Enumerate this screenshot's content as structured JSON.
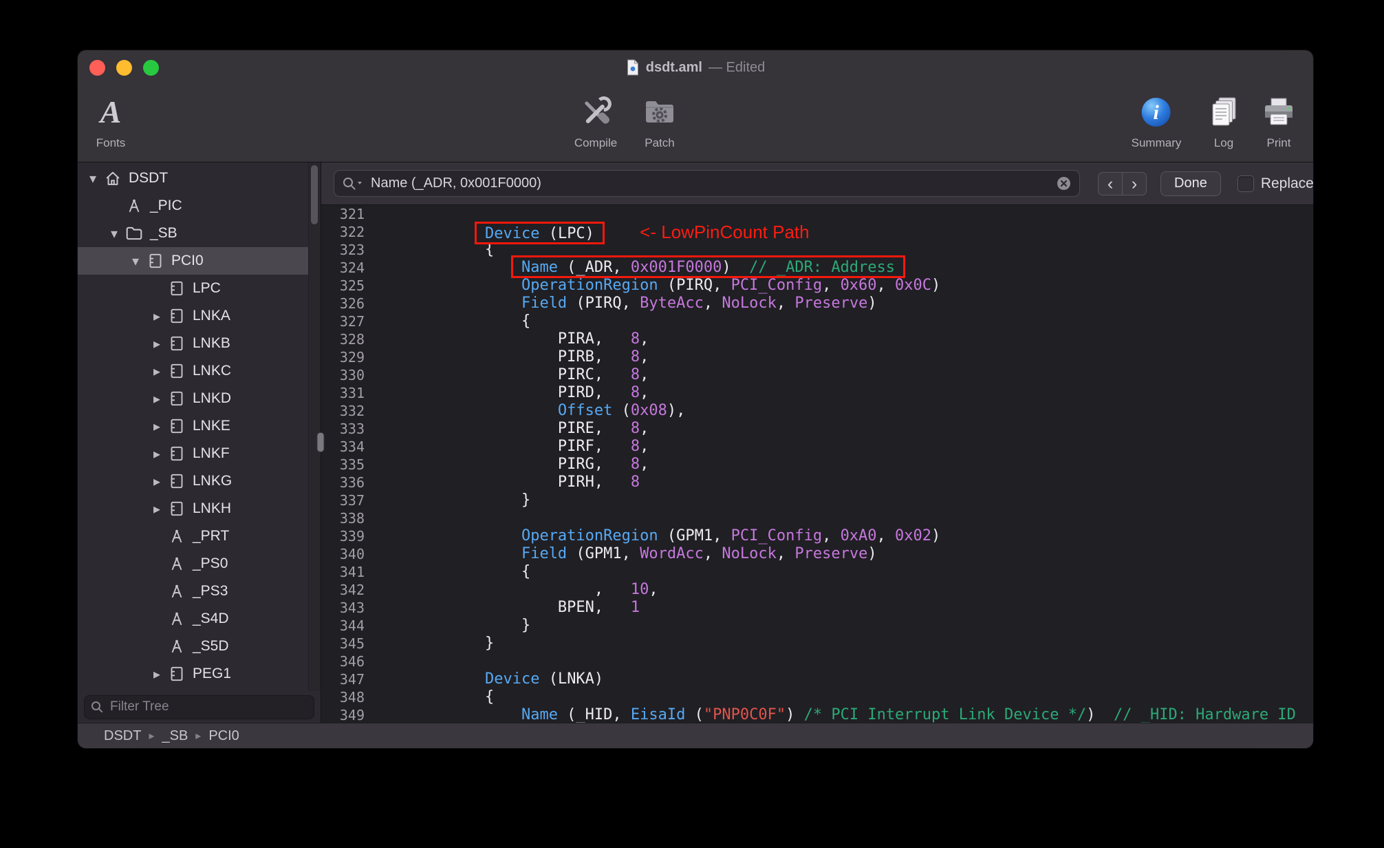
{
  "window": {
    "title": "dsdt.aml",
    "title_suffix": "— Edited"
  },
  "toolbar": {
    "fonts_glyph": "A",
    "fonts": "Fonts",
    "compile": "Compile",
    "patch": "Patch",
    "summary": "Summary",
    "log": "Log",
    "print": "Print"
  },
  "sidebar": {
    "items": [
      {
        "label": "DSDT",
        "icon": "house",
        "indent": 0,
        "disclosure": "open"
      },
      {
        "label": "_PIC",
        "icon": "method",
        "indent": 1,
        "disclosure": "none"
      },
      {
        "label": "_SB",
        "icon": "folder",
        "indent": 1,
        "disclosure": "open"
      },
      {
        "label": "PCI0",
        "icon": "device",
        "indent": 2,
        "disclosure": "open",
        "selected": true
      },
      {
        "label": "LPC",
        "icon": "device",
        "indent": 3,
        "disclosure": "none"
      },
      {
        "label": "LNKA",
        "icon": "device",
        "indent": 3,
        "disclosure": "closed"
      },
      {
        "label": "LNKB",
        "icon": "device",
        "indent": 3,
        "disclosure": "closed"
      },
      {
        "label": "LNKC",
        "icon": "device",
        "indent": 3,
        "disclosure": "closed"
      },
      {
        "label": "LNKD",
        "icon": "device",
        "indent": 3,
        "disclosure": "closed"
      },
      {
        "label": "LNKE",
        "icon": "device",
        "indent": 3,
        "disclosure": "closed"
      },
      {
        "label": "LNKF",
        "icon": "device",
        "indent": 3,
        "disclosure": "closed"
      },
      {
        "label": "LNKG",
        "icon": "device",
        "indent": 3,
        "disclosure": "closed"
      },
      {
        "label": "LNKH",
        "icon": "device",
        "indent": 3,
        "disclosure": "closed"
      },
      {
        "label": "_PRT",
        "icon": "method",
        "indent": 3,
        "disclosure": "none"
      },
      {
        "label": "_PS0",
        "icon": "method",
        "indent": 3,
        "disclosure": "none"
      },
      {
        "label": "_PS3",
        "icon": "method",
        "indent": 3,
        "disclosure": "none"
      },
      {
        "label": "_S4D",
        "icon": "method",
        "indent": 3,
        "disclosure": "none"
      },
      {
        "label": "_S5D",
        "icon": "method",
        "indent": 3,
        "disclosure": "none"
      },
      {
        "label": "PEG1",
        "icon": "device",
        "indent": 3,
        "disclosure": "closed"
      }
    ],
    "filter_placeholder": "Filter Tree",
    "breadcrumb": [
      "DSDT",
      "_SB",
      "PCI0"
    ],
    "breadcrumb_separator": "▸"
  },
  "findbar": {
    "query": "Name (_ADR, 0x001F0000)",
    "prev": "‹",
    "next": "›",
    "done": "Done",
    "replace": "Replace"
  },
  "annotation": {
    "text": "<- LowPinCount Path",
    "color": "#FB1D12"
  },
  "editor": {
    "lines": [
      {
        "n": 321,
        "s": []
      },
      {
        "n": 322,
        "s": [
          {
            "t": "        "
          },
          {
            "t": "Device",
            "c": "k",
            "w": 1
          },
          {
            "t": " (LPC)",
            "w": 1
          },
          {
            "t": "     "
          },
          {
            "t": "<- LowPinCount Path",
            "c": "a"
          }
        ]
      },
      {
        "n": 323,
        "s": [
          {
            "t": "        {"
          }
        ]
      },
      {
        "n": 324,
        "s": [
          {
            "t": "            "
          },
          {
            "t": "Name",
            "c": "k",
            "w": 1
          },
          {
            "t": " (_ADR, ",
            "w": 1
          },
          {
            "t": "0x001F0000",
            "c": "n",
            "w": 1
          },
          {
            "t": ")  ",
            "w": 1
          },
          {
            "t": "// _ADR: Address",
            "c": "c",
            "w": 1
          }
        ]
      },
      {
        "n": 325,
        "s": [
          {
            "t": "            "
          },
          {
            "t": "OperationRegion",
            "c": "k"
          },
          {
            "t": " (PIRQ, "
          },
          {
            "t": "PCI_Config",
            "c": "n"
          },
          {
            "t": ", "
          },
          {
            "t": "0x60",
            "c": "n"
          },
          {
            "t": ", "
          },
          {
            "t": "0x0C",
            "c": "n"
          },
          {
            "t": ")"
          }
        ]
      },
      {
        "n": 326,
        "s": [
          {
            "t": "            "
          },
          {
            "t": "Field",
            "c": "k"
          },
          {
            "t": " (PIRQ, "
          },
          {
            "t": "ByteAcc",
            "c": "n"
          },
          {
            "t": ", "
          },
          {
            "t": "NoLock",
            "c": "n"
          },
          {
            "t": ", "
          },
          {
            "t": "Preserve",
            "c": "n"
          },
          {
            "t": ")"
          }
        ]
      },
      {
        "n": 327,
        "s": [
          {
            "t": "            {"
          }
        ]
      },
      {
        "n": 328,
        "s": [
          {
            "t": "                PIRA,   "
          },
          {
            "t": "8",
            "c": "n"
          },
          {
            "t": ","
          }
        ]
      },
      {
        "n": 329,
        "s": [
          {
            "t": "                PIRB,   "
          },
          {
            "t": "8",
            "c": "n"
          },
          {
            "t": ","
          }
        ]
      },
      {
        "n": 330,
        "s": [
          {
            "t": "                PIRC,   "
          },
          {
            "t": "8",
            "c": "n"
          },
          {
            "t": ","
          }
        ]
      },
      {
        "n": 331,
        "s": [
          {
            "t": "                PIRD,   "
          },
          {
            "t": "8",
            "c": "n"
          },
          {
            "t": ","
          }
        ]
      },
      {
        "n": 332,
        "s": [
          {
            "t": "                "
          },
          {
            "t": "Offset",
            "c": "k"
          },
          {
            "t": " ("
          },
          {
            "t": "0x08",
            "c": "n"
          },
          {
            "t": "),"
          }
        ]
      },
      {
        "n": 333,
        "s": [
          {
            "t": "                PIRE,   "
          },
          {
            "t": "8",
            "c": "n"
          },
          {
            "t": ","
          }
        ]
      },
      {
        "n": 334,
        "s": [
          {
            "t": "                PIRF,   "
          },
          {
            "t": "8",
            "c": "n"
          },
          {
            "t": ","
          }
        ]
      },
      {
        "n": 335,
        "s": [
          {
            "t": "                PIRG,   "
          },
          {
            "t": "8",
            "c": "n"
          },
          {
            "t": ","
          }
        ]
      },
      {
        "n": 336,
        "s": [
          {
            "t": "                PIRH,   "
          },
          {
            "t": "8",
            "c": "n"
          }
        ]
      },
      {
        "n": 337,
        "s": [
          {
            "t": "            }"
          }
        ]
      },
      {
        "n": 338,
        "s": []
      },
      {
        "n": 339,
        "s": [
          {
            "t": "            "
          },
          {
            "t": "OperationRegion",
            "c": "k"
          },
          {
            "t": " (GPM1, "
          },
          {
            "t": "PCI_Config",
            "c": "n"
          },
          {
            "t": ", "
          },
          {
            "t": "0xA0",
            "c": "n"
          },
          {
            "t": ", "
          },
          {
            "t": "0x02",
            "c": "n"
          },
          {
            "t": ")"
          }
        ]
      },
      {
        "n": 340,
        "s": [
          {
            "t": "            "
          },
          {
            "t": "Field",
            "c": "k"
          },
          {
            "t": " (GPM1, "
          },
          {
            "t": "WordAcc",
            "c": "n"
          },
          {
            "t": ", "
          },
          {
            "t": "NoLock",
            "c": "n"
          },
          {
            "t": ", "
          },
          {
            "t": "Preserve",
            "c": "n"
          },
          {
            "t": ")"
          }
        ]
      },
      {
        "n": 341,
        "s": [
          {
            "t": "            {"
          }
        ]
      },
      {
        "n": 342,
        "s": [
          {
            "t": "                    ,   "
          },
          {
            "t": "10",
            "c": "n"
          },
          {
            "t": ","
          }
        ]
      },
      {
        "n": 343,
        "s": [
          {
            "t": "                BPEN,   "
          },
          {
            "t": "1",
            "c": "n"
          }
        ]
      },
      {
        "n": 344,
        "s": [
          {
            "t": "            }"
          }
        ]
      },
      {
        "n": 345,
        "s": [
          {
            "t": "        }"
          }
        ]
      },
      {
        "n": 346,
        "s": []
      },
      {
        "n": 347,
        "s": [
          {
            "t": "        "
          },
          {
            "t": "Device",
            "c": "k"
          },
          {
            "t": " (LNKA)"
          }
        ]
      },
      {
        "n": 348,
        "s": [
          {
            "t": "        {"
          }
        ]
      },
      {
        "n": 349,
        "s": [
          {
            "t": "            "
          },
          {
            "t": "Name",
            "c": "k"
          },
          {
            "t": " (_HID, "
          },
          {
            "t": "EisaId",
            "c": "k"
          },
          {
            "t": " ("
          },
          {
            "t": "\"PNP0C0F\"",
            "c": "s"
          },
          {
            "t": ") "
          },
          {
            "t": "/* PCI Interrupt Link Device */",
            "c": "c"
          },
          {
            "t": ")  "
          },
          {
            "t": "// _HID: Hardware ID",
            "c": "c"
          }
        ]
      }
    ]
  }
}
